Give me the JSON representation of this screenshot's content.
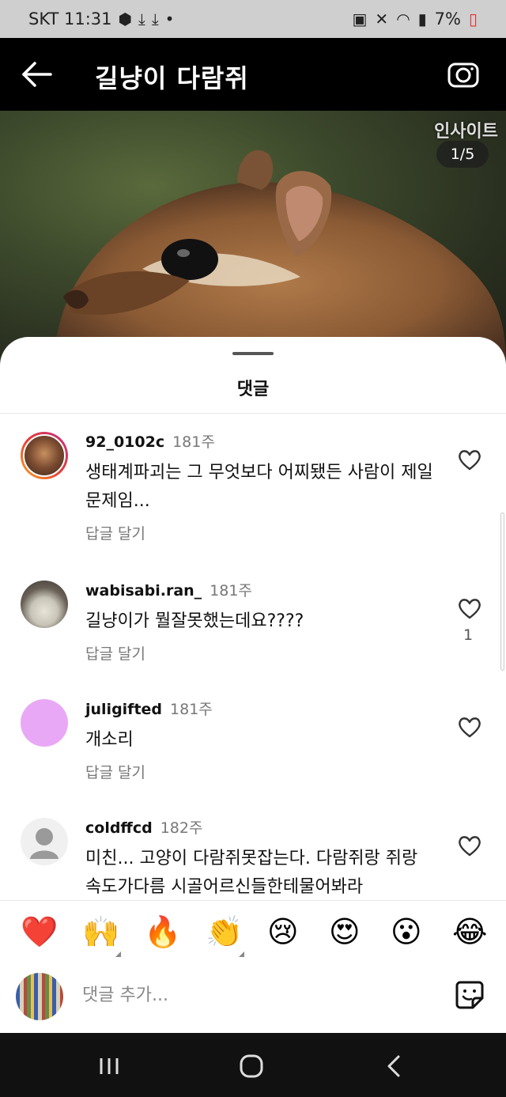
{
  "status_bar": {
    "carrier_time": "SKT 11:31",
    "battery": "7%"
  },
  "header": {
    "title": "길냥이 다람쥐"
  },
  "photo": {
    "insight_label": "인사이트",
    "page_counter": "1/5"
  },
  "sheet": {
    "title": "댓글"
  },
  "comments": [
    {
      "username": "92_0102c",
      "time": "181주",
      "text": "생태계파괴는 그 무엇보다 어찌됐든 사람이 제일 문제임...",
      "reply": "답글 달기",
      "likes": ""
    },
    {
      "username": "wabisabi.ran_",
      "time": "181주",
      "text": "길냥이가 뭘잘못했는데요????",
      "reply": "답글 달기",
      "likes": "1"
    },
    {
      "username": "juligifted",
      "time": "181주",
      "text": "개소리",
      "reply": "답글 달기",
      "likes": ""
    },
    {
      "username": "coldffcd",
      "time": "182주",
      "text": "미친... 고양이 다람쥐못잡는다. 다람쥐랑 쥐랑 속도가다름 시골어르신들한테물어봐라",
      "reply": "",
      "likes": ""
    }
  ],
  "reactions": [
    "❤️",
    "🙌",
    "🔥",
    "👏",
    "😢",
    "😍",
    "😮",
    "😂"
  ],
  "input": {
    "placeholder": "댓글 추가..."
  },
  "colors": {
    "story_ring_start": "#f9a825",
    "story_ring_end": "#c13584",
    "placeholder_avatar": "#e9a8f5"
  }
}
